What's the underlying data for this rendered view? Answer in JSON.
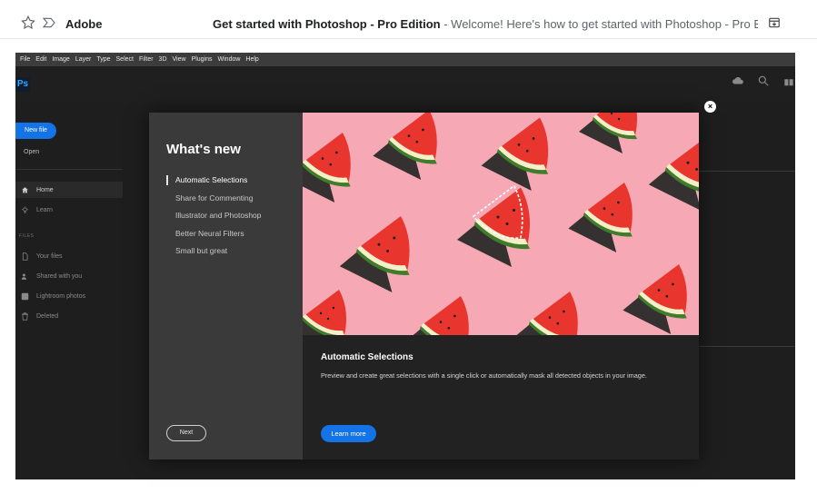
{
  "mail": {
    "sender": "Adobe",
    "subject": "Get started with Photoshop - Pro Edition",
    "snippet": " - Welcome! Here's how to get started with Photoshop - Pro Edition. ..."
  },
  "menu": [
    "File",
    "Edit",
    "Image",
    "Layer",
    "Type",
    "Select",
    "Filter",
    "3D",
    "View",
    "Plugins",
    "Window",
    "Help"
  ],
  "app": {
    "logo": "Ps",
    "new_file": "New file",
    "open": "Open",
    "nav": [
      {
        "label": "Home",
        "icon": "home-icon"
      },
      {
        "label": "Learn",
        "icon": "lightbulb-icon"
      }
    ],
    "files_label": "FILES",
    "files": [
      {
        "label": "Your files",
        "icon": "file-icon"
      },
      {
        "label": "Shared with you",
        "icon": "users-icon"
      },
      {
        "label": "Lightroom photos",
        "icon": "lightroom-icon"
      },
      {
        "label": "Deleted",
        "icon": "trash-icon"
      }
    ]
  },
  "modal": {
    "title": "What's new",
    "features": [
      "Automatic Selections",
      "Share for Commenting",
      "Illustrator and Photoshop",
      "Better Neural Filters",
      "Small but great"
    ],
    "active_index": 0,
    "next": "Next",
    "detail_title": "Automatic Selections",
    "detail_desc": "Preview and create great selections with a single click or automatically mask all detected objects in your image.",
    "learn_more": "Learn more",
    "close": "×"
  },
  "colors": {
    "accent": "#1473e6",
    "hero_bg": "#f6a8b5",
    "watermelon": "#e8362f"
  }
}
